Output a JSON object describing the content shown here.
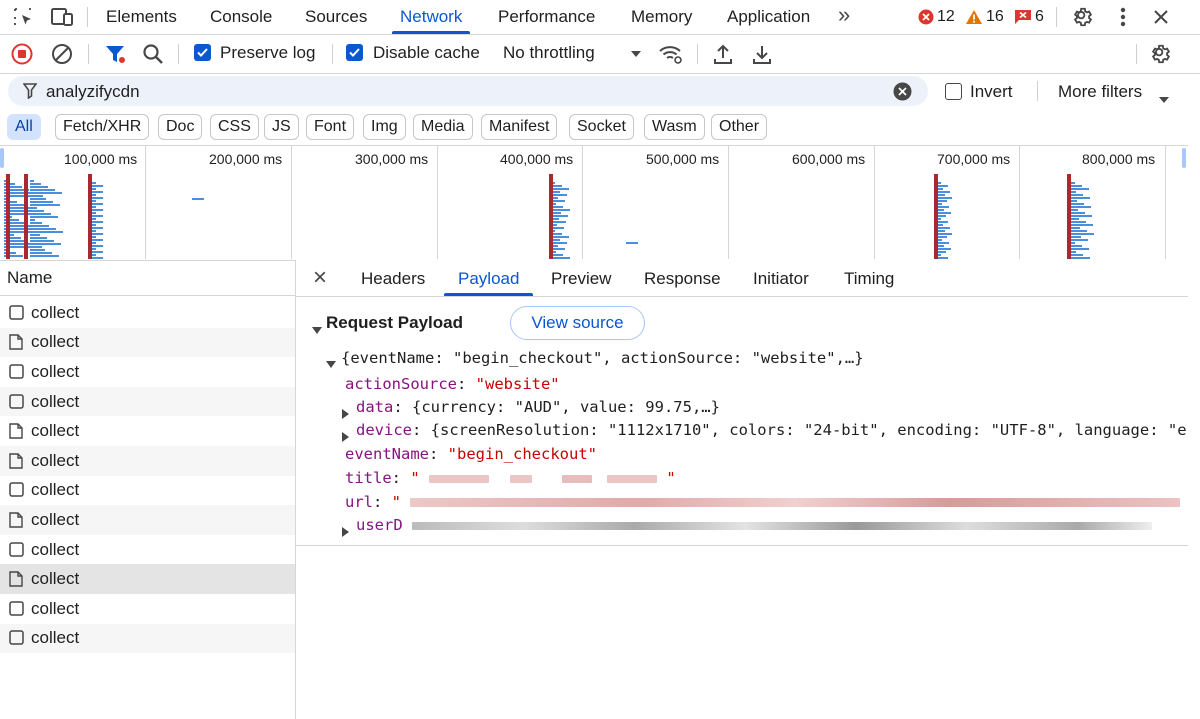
{
  "tabs": {
    "items": [
      "Elements",
      "Console",
      "Sources",
      "Network",
      "Performance",
      "Memory",
      "Application"
    ],
    "active": "Network",
    "more": "»",
    "errors": "12",
    "warnings": "16",
    "issues": "6"
  },
  "toolbar": {
    "preserve_log": "Preserve log",
    "preserve_log_checked": true,
    "disable_cache": "Disable cache",
    "disable_cache_checked": true,
    "throttling": "No throttling"
  },
  "filter": {
    "value": "analyzifycdn",
    "invert": "Invert",
    "invert_checked": false,
    "more_filters": "More filters"
  },
  "types": [
    "All",
    "Fetch/XHR",
    "Doc",
    "CSS",
    "JS",
    "Font",
    "Img",
    "Media",
    "Manifest",
    "Socket",
    "Wasm",
    "Other"
  ],
  "active_type": "All",
  "overview": {
    "labels": [
      "100,000 ms",
      "200,000 ms",
      "300,000 ms",
      "400,000 ms",
      "500,000 ms",
      "600,000 ms",
      "700,000 ms",
      "800,000 ms"
    ]
  },
  "requests": {
    "header": "Name",
    "items": [
      "collect",
      "collect",
      "collect",
      "collect",
      "collect",
      "collect",
      "collect",
      "collect",
      "collect",
      "collect",
      "collect",
      "collect"
    ],
    "selected_index": 9
  },
  "details": {
    "close": "×",
    "tabs": [
      "Headers",
      "Payload",
      "Preview",
      "Response",
      "Initiator",
      "Timing"
    ],
    "active": "Payload",
    "section_title": "Request Payload",
    "view_source": "View source",
    "root_summary": "{eventName: \"begin_checkout\", actionSource: \"website\",…}",
    "props": {
      "actionSource_key": "actionSource",
      "actionSource_val": "\"website\"",
      "data_key": "data",
      "data_val": "{currency: \"AUD\", value: 99.75,…}",
      "device_key": "device",
      "device_val": "{screenResolution: \"1112x1710\", colors: \"24-bit\", encoding: \"UTF-8\", language: \"e",
      "eventName_key": "eventName",
      "eventName_val": "\"begin_checkout\"",
      "title_key": "title",
      "url_key": "url",
      "userD_key": "userD"
    }
  },
  "colors": {
    "accent": "#0b57d0",
    "error": "#dc362e",
    "warning": "#e37400",
    "key": "#881280",
    "string": "#c80000"
  }
}
